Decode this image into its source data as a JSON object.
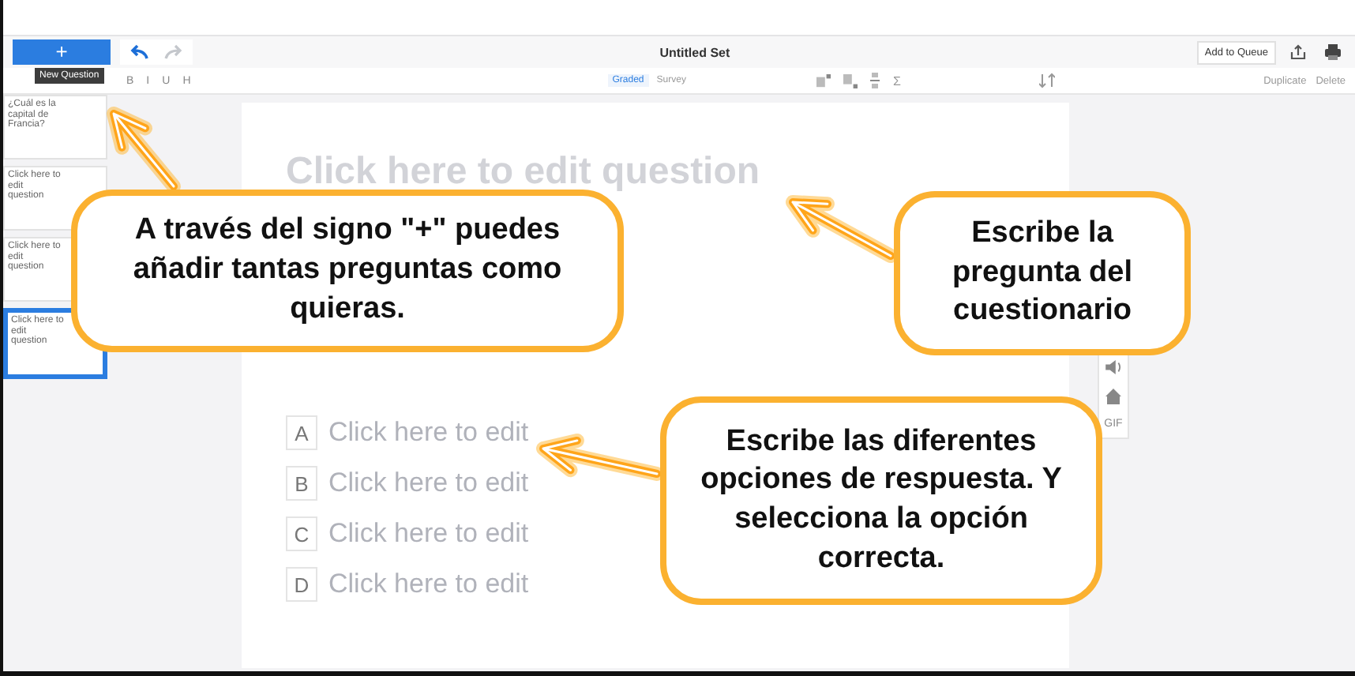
{
  "toolbar": {
    "new_button": "+",
    "tooltip": "New Question",
    "title": "Untitled Set",
    "queue_button": "Add to Queue"
  },
  "format_bar": {
    "format_buttons": [
      "B",
      "I",
      "U",
      "H"
    ],
    "modes": [
      {
        "label": "Graded",
        "selected": true
      },
      {
        "label": "Survey",
        "selected": false
      }
    ],
    "math_symbol": "Σ",
    "actions": [
      "Duplicate",
      "Delete"
    ]
  },
  "slides": [
    {
      "question": "¿Cuál es la capital de Francia?",
      "selected": false
    },
    {
      "question": "Click here to edit question",
      "selected": false
    },
    {
      "question": "Click here to edit question",
      "selected": false
    },
    {
      "question": "Click here to edit question",
      "selected": true
    }
  ],
  "question": {
    "placeholder": "Click here to edit question"
  },
  "answers": [
    {
      "letter": "A",
      "placeholder": "Click here to edit"
    },
    {
      "letter": "B",
      "placeholder": "Click here to edit"
    },
    {
      "letter": "C",
      "placeholder": "Click here to edit"
    },
    {
      "letter": "D",
      "placeholder": "Click here to edit"
    }
  ],
  "side_tools": {
    "gif_label": "GIF"
  },
  "callouts": [
    {
      "text": "A través del signo \"+\" puedes añadir tantas preguntas como quieras."
    },
    {
      "text": "Escribe la pregunta del cuestionario"
    },
    {
      "text": "Escribe las diferentes opciones de respuesta. Y selecciona la opción correcta."
    }
  ]
}
